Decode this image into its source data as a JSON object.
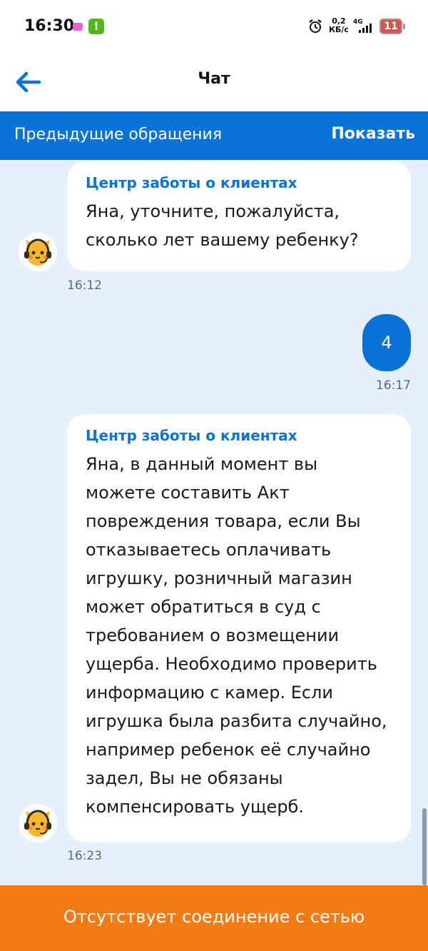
{
  "status_bar": {
    "time": "16:30",
    "speed_value": "0,2",
    "speed_unit": "КБ/с",
    "network_type": "4G",
    "battery": "11"
  },
  "header": {
    "title": "Чат",
    "back_icon": "arrow-left-icon"
  },
  "previous_requests": {
    "label": "Предыдущие обращения",
    "action": "Показать"
  },
  "messages": [
    {
      "direction": "incoming",
      "sender": "Центр заботы о клиентах",
      "text": "Яна, уточните, пожалуйста, сколько лет вашему ребенку?",
      "time": "16:12"
    },
    {
      "direction": "outgoing",
      "text": "4",
      "time": "16:17"
    },
    {
      "direction": "incoming",
      "sender": "Центр заботы о клиентах",
      "text": "Яна, в данный момент вы можете составить Акт повреждения товара, если Вы отказываетесь оплачивать игрушку, розничный магазин может обратиться в суд с требованием о возмещении ущерба. Необходимо проверить информацию с камер. Если игрушка была разбита случайно, например ребенок её случайно задел, Вы не обязаны компенсировать ущерб.",
      "time": "16:23"
    }
  ],
  "offline_banner": "Отсутствует соединение с сетью",
  "colors": {
    "accent": "#0b73d8",
    "chat_background": "#e6f0fb",
    "offline": "#f47b14"
  }
}
